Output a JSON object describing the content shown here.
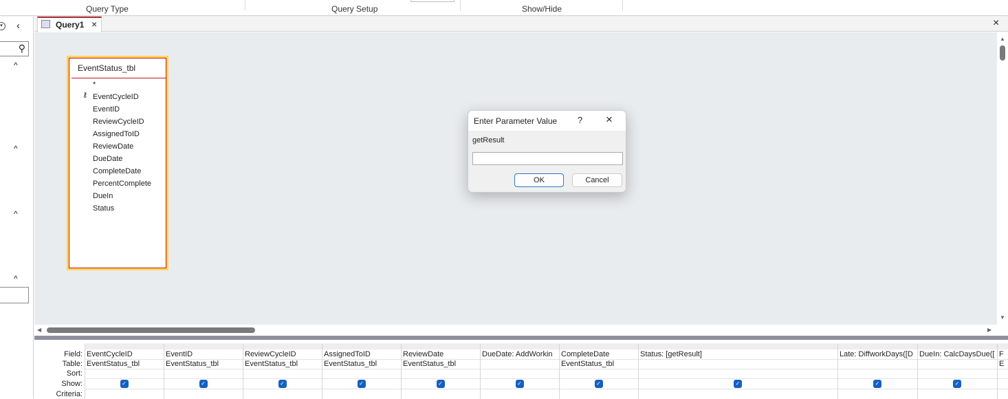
{
  "ribbon": {
    "groups": [
      "Query Type",
      "Query Setup",
      "Show/Hide"
    ]
  },
  "tab": {
    "label": "Query1"
  },
  "table_box": {
    "title": "EventStatus_tbl",
    "fields": [
      "*",
      "EventCycleID",
      "EventID",
      "ReviewCycleID",
      "AssignedToID",
      "ReviewDate",
      "DueDate",
      "CompleteDate",
      "PercentComplete",
      "DueIn",
      "Status"
    ]
  },
  "grid": {
    "row_labels": [
      "Field:",
      "Table:",
      "Sort:",
      "Show:",
      "Criteria:"
    ],
    "columns": [
      {
        "field": "EventCycleID",
        "table": "EventStatus_tbl",
        "show": true
      },
      {
        "field": "EventID",
        "table": "EventStatus_tbl",
        "show": true
      },
      {
        "field": "ReviewCycleID",
        "table": "EventStatus_tbl",
        "show": true
      },
      {
        "field": "AssignedToID",
        "table": "EventStatus_tbl",
        "show": true
      },
      {
        "field": "ReviewDate",
        "table": "EventStatus_tbl",
        "show": true
      },
      {
        "field": "DueDate: AddWorkin",
        "table": "",
        "show": true
      },
      {
        "field": "CompleteDate",
        "table": "EventStatus_tbl",
        "show": true
      },
      {
        "field": "Status: [getResult]",
        "table": "",
        "show": true
      },
      {
        "field": "Late: DiffworkDays([D",
        "table": "",
        "show": true
      },
      {
        "field": "DueIn: CalcDaysDue([",
        "table": "",
        "show": true
      },
      {
        "field": "F",
        "table": "E",
        "show": false
      }
    ]
  },
  "dialog": {
    "title": "Enter Parameter Value",
    "help": "?",
    "prompt": "getResult",
    "value": "",
    "ok": "OK",
    "cancel": "Cancel"
  },
  "colors": {
    "accent": "#a4262c",
    "checkbox": "#1460c0",
    "canvas": "#e9ecef"
  }
}
